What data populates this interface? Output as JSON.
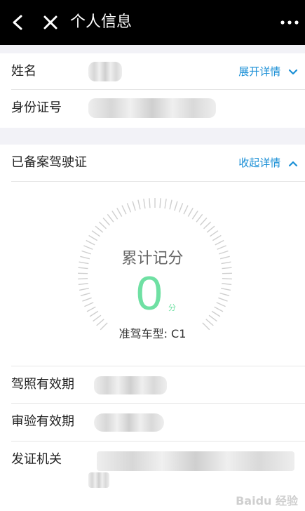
{
  "header": {
    "title": "个人信息",
    "back_icon": "chevron-left-icon",
    "close_icon": "close-icon",
    "more_icon": "more-dots-icon"
  },
  "personal": {
    "name_label": "姓名",
    "expand_label": "展开详情",
    "id_label": "身份证号"
  },
  "license": {
    "section_label": "已备案驾驶证",
    "collapse_label": "收起详情",
    "score_title": "累计记分",
    "score_value": "0",
    "score_unit": "分",
    "vehicle_type": "准驾车型: C1",
    "validity_label": "驾照有效期",
    "inspection_label": "审验有效期",
    "issuer_label": "发证机关"
  },
  "colors": {
    "header_bg": "#000000",
    "accent": "#1a8fd6",
    "score_green": "#6fe0a3",
    "section_gap": "#f2f2f7"
  },
  "watermark": "Baidu 经验"
}
